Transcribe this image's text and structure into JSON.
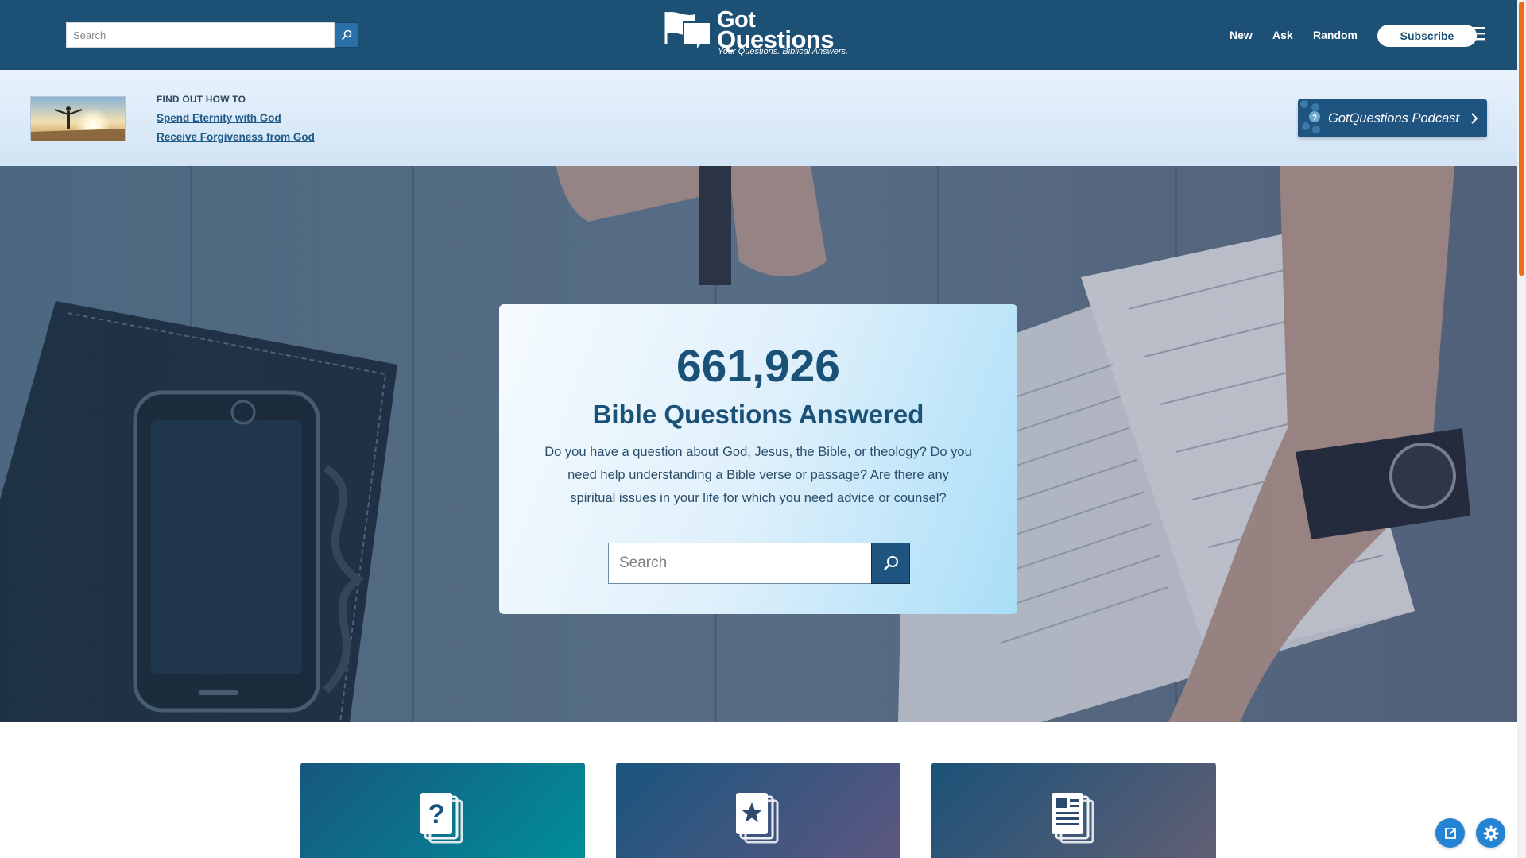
{
  "header": {
    "search_placeholder": "Search",
    "logo_line1": "Got",
    "logo_line2": "Questions",
    "logo_tagline": "Your Questions. Biblical Answers.",
    "nav": {
      "new": "New",
      "ask": "Ask",
      "random": "Random"
    },
    "subscribe_label": "Subscribe"
  },
  "promo": {
    "kicker": "FIND OUT HOW TO",
    "link1": "Spend Eternity with God",
    "link2": "Receive Forgiveness from God",
    "podcast_label": "GotQuestions Podcast"
  },
  "hero": {
    "count": "661,926",
    "title": "Bible Questions Answered",
    "description": "Do you have a question about God, Jesus, the Bible, or theology? Do you need help understanding a Bible verse or passage? Are there any spiritual issues in your life for which you need advice or counsel?",
    "search_placeholder": "Search"
  },
  "tiles": [
    {
      "icon": "question-document-icon"
    },
    {
      "icon": "star-document-icon"
    },
    {
      "icon": "article-document-icon"
    }
  ],
  "floating": {
    "share_icon": "share-icon",
    "settings_icon": "gear-icon"
  },
  "colors": {
    "header_bg": "#1d5075",
    "accent_blue": "#1f5480",
    "promo_bg": "#dbe9f7",
    "fab_blue": "#2484d4",
    "scroll_thumb": "#f06a1a"
  }
}
